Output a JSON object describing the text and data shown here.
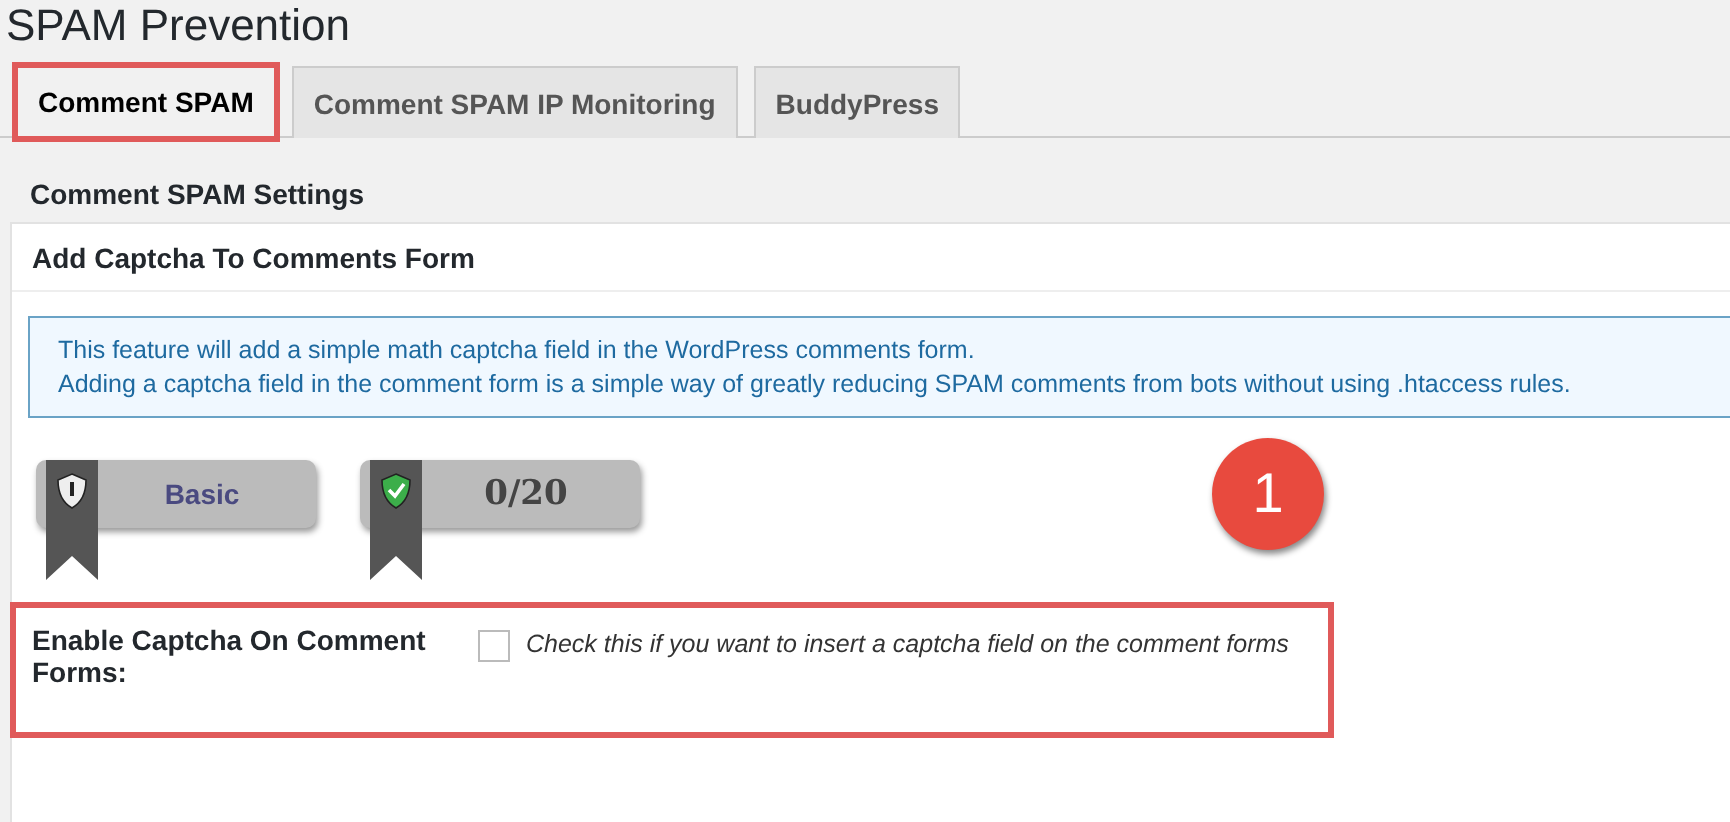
{
  "page_title": "SPAM Prevention",
  "tabs": [
    {
      "label": "Comment SPAM",
      "selected": true,
      "highlighted": true
    },
    {
      "label": "Comment SPAM IP Monitoring",
      "selected": false,
      "highlighted": false
    },
    {
      "label": "BuddyPress",
      "selected": false,
      "highlighted": false
    }
  ],
  "section_title": "Comment SPAM Settings",
  "card": {
    "title": "Add Captcha To Comments Form",
    "info_lines": [
      "This feature will add a simple math captcha field in the WordPress comments form.",
      "Adding a captcha field in the comment form is a simple way of greatly reducing SPAM comments from bots without using .htaccess rules."
    ],
    "badges": [
      {
        "kind": "level",
        "text": "Basic"
      },
      {
        "kind": "score",
        "text": "0/20"
      }
    ],
    "callout": "1",
    "setting": {
      "label": "Enable Captcha On Comment Forms:",
      "checked": false,
      "description": "Check this if you want to insert a captcha field on the comment forms",
      "highlighted": true
    }
  }
}
